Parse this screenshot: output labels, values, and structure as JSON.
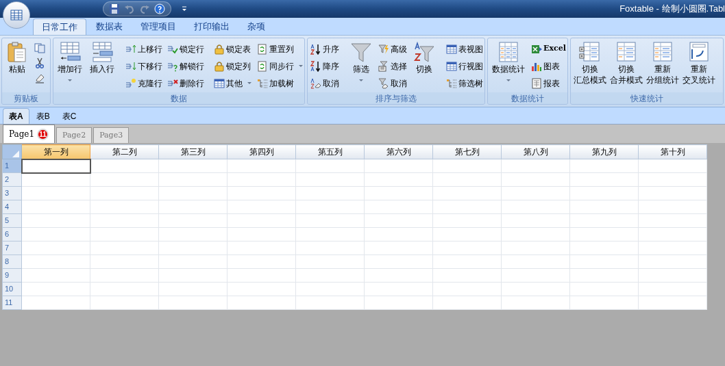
{
  "window": {
    "title": "Foxtable - 绘制小圆圈.Tabl"
  },
  "ribbon_tabs": [
    {
      "label": "日常工作",
      "selected": true
    },
    {
      "label": "数据表",
      "selected": false
    },
    {
      "label": "管理项目",
      "selected": false
    },
    {
      "label": "打印输出",
      "selected": false
    },
    {
      "label": "杂项",
      "selected": false
    }
  ],
  "ribbon_groups": [
    {
      "title": "剪贴板",
      "columns": [
        {
          "kind": "large",
          "lines": [
            "粘贴"
          ],
          "dropdown": false
        },
        {
          "kind": "icons"
        }
      ]
    },
    {
      "title": "数据",
      "columns": [
        {
          "kind": "large",
          "lines": [
            "增加行"
          ],
          "dropdown": true
        },
        {
          "kind": "large",
          "lines": [
            "插入行"
          ],
          "dropdown": false
        },
        {
          "kind": "separator"
        },
        {
          "kind": "stack",
          "items": [
            {
              "label": "上移行",
              "dropdown": false
            },
            {
              "label": "下移行",
              "dropdown": false
            },
            {
              "label": "克隆行",
              "dropdown": false
            }
          ]
        },
        {
          "kind": "stack",
          "items": [
            {
              "label": "锁定行",
              "dropdown": false
            },
            {
              "label": "解锁行",
              "dropdown": false
            },
            {
              "label": "删除行",
              "dropdown": false
            }
          ]
        },
        {
          "kind": "separator"
        },
        {
          "kind": "stack",
          "items": [
            {
              "label": "锁定表",
              "dropdown": false
            },
            {
              "label": "锁定列",
              "dropdown": false
            },
            {
              "label": "其他",
              "dropdown": true
            }
          ]
        },
        {
          "kind": "stack",
          "items": [
            {
              "label": "重置列",
              "dropdown": false
            },
            {
              "label": "同步行",
              "dropdown": true
            },
            {
              "label": "加载树",
              "dropdown": false
            }
          ]
        }
      ]
    },
    {
      "title": "排序与筛选",
      "columns": [
        {
          "kind": "stack",
          "items": [
            {
              "label": "升序",
              "dropdown": false
            },
            {
              "label": "降序",
              "dropdown": false
            },
            {
              "label": "取消",
              "dropdown": false
            }
          ]
        },
        {
          "kind": "separator"
        },
        {
          "kind": "large",
          "lines": [
            "筛选"
          ],
          "dropdown": true
        },
        {
          "kind": "stack",
          "items": [
            {
              "label": "高级",
              "dropdown": false
            },
            {
              "label": "选择",
              "dropdown": false
            },
            {
              "label": "取消",
              "dropdown": false
            }
          ]
        },
        {
          "kind": "large",
          "lines": [
            "切换"
          ],
          "dropdown": false
        },
        {
          "kind": "separator"
        },
        {
          "kind": "stack",
          "items": [
            {
              "label": "表视图",
              "dropdown": false
            },
            {
              "label": "行视图",
              "dropdown": false
            },
            {
              "label": "筛选树",
              "dropdown": false
            }
          ]
        }
      ]
    },
    {
      "title": "数据统计",
      "columns": [
        {
          "kind": "large",
          "lines": [
            "数据统计"
          ],
          "dropdown": true
        },
        {
          "kind": "stack",
          "items": [
            {
              "label": "Excel",
              "dropdown": false
            },
            {
              "label": "图表",
              "dropdown": false
            },
            {
              "label": "报表",
              "dropdown": false
            }
          ]
        }
      ]
    },
    {
      "title": "快速统计",
      "columns": [
        {
          "kind": "large",
          "lines": [
            "切换",
            "汇总模式"
          ],
          "dropdown": false
        },
        {
          "kind": "large",
          "lines": [
            "切换",
            "合并模式"
          ],
          "dropdown": false
        },
        {
          "kind": "large",
          "lines": [
            "重新",
            "分组统计"
          ],
          "dropdown": false
        },
        {
          "kind": "large",
          "lines": [
            "重新",
            "交叉统计"
          ],
          "dropdown": false
        }
      ]
    }
  ],
  "sheet_tabs": [
    {
      "label": "表A",
      "selected": true
    },
    {
      "label": "表B",
      "selected": false
    },
    {
      "label": "表C",
      "selected": false
    }
  ],
  "page_tabs": [
    {
      "label": "Page1",
      "selected": true,
      "badge": "11"
    },
    {
      "label": "Page2",
      "selected": false
    },
    {
      "label": "Page3",
      "selected": false
    }
  ],
  "grid": {
    "columns": [
      {
        "label": "第一列",
        "selected": true
      },
      {
        "label": "第二列",
        "selected": false
      },
      {
        "label": "第三列",
        "selected": false
      },
      {
        "label": "第四列",
        "selected": false
      },
      {
        "label": "第五列",
        "selected": false
      },
      {
        "label": "第六列",
        "selected": false
      },
      {
        "label": "第七列",
        "selected": false
      },
      {
        "label": "第八列",
        "selected": false
      },
      {
        "label": "第九列",
        "selected": false
      },
      {
        "label": "第十列",
        "selected": false
      }
    ],
    "rows": [
      {
        "label": "1",
        "selected": true
      },
      {
        "label": "2",
        "selected": false
      },
      {
        "label": "3",
        "selected": false
      },
      {
        "label": "4",
        "selected": false
      },
      {
        "label": "5",
        "selected": false
      },
      {
        "label": "6",
        "selected": false
      },
      {
        "label": "7",
        "selected": false
      },
      {
        "label": "8",
        "selected": false
      },
      {
        "label": "9",
        "selected": false
      },
      {
        "label": "10",
        "selected": false
      },
      {
        "label": "11",
        "selected": false
      }
    ]
  }
}
